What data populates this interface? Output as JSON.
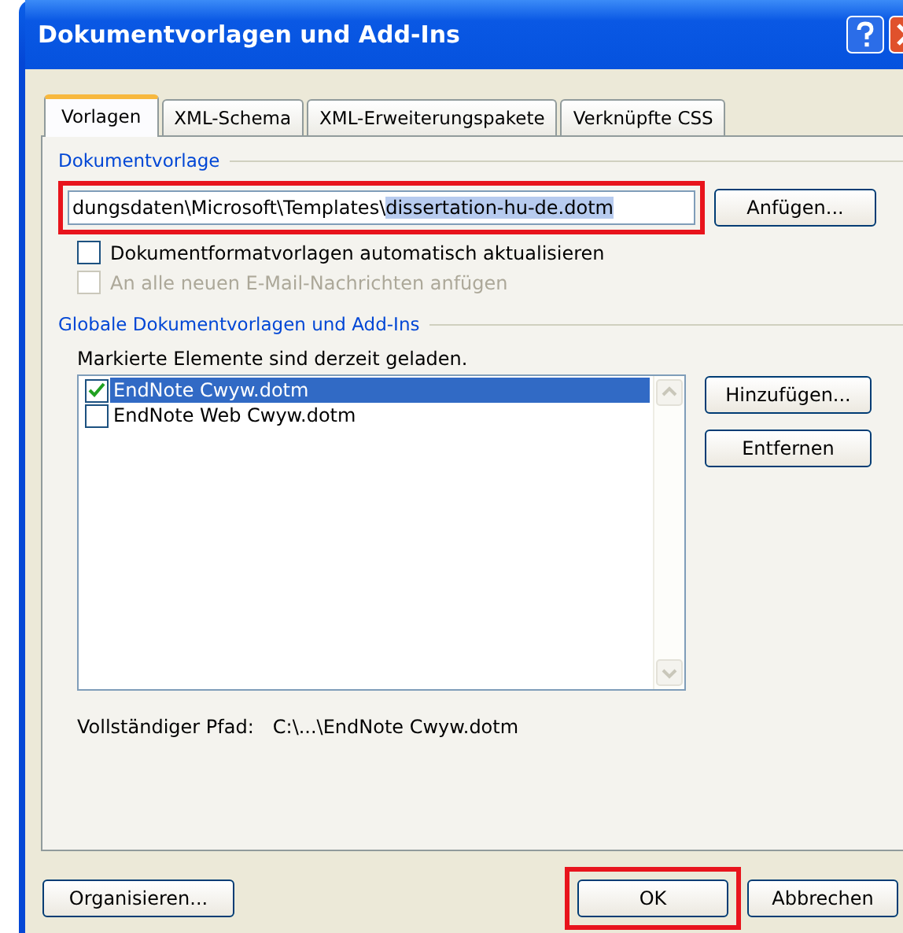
{
  "window": {
    "title": "Dokumentvorlagen und Add-Ins"
  },
  "tabs": [
    {
      "label": "Vorlagen",
      "selected": true
    },
    {
      "label": "XML-Schema",
      "selected": false
    },
    {
      "label": "XML-Erweiterungspakete",
      "selected": false
    },
    {
      "label": "Verknüpfte CSS",
      "selected": false
    }
  ],
  "template_section": {
    "heading": "Dokumentvorlage",
    "field": {
      "value": "dungsdaten\\Microsoft\\Templates\\",
      "selection": "dissertation-hu-de.dotm",
      "highlighted": true
    },
    "attach_button": "Anfügen...",
    "options": [
      {
        "label": "Dokumentformatvorlagen automatisch aktualisieren",
        "checked": false,
        "disabled": false
      },
      {
        "label": "An alle neuen E-Mail-Nachrichten anfügen",
        "checked": false,
        "disabled": true
      }
    ]
  },
  "global_section": {
    "heading": "Globale Dokumentvorlagen und Add-Ins",
    "hint": "Markierte Elemente sind derzeit geladen.",
    "items": [
      {
        "label": "EndNote Cwyw.dotm",
        "checked": true,
        "selected": true
      },
      {
        "label": "EndNote Web Cwyw.dotm",
        "checked": false,
        "selected": false
      }
    ],
    "buttons": [
      "Hinzufügen...",
      "Entfernen"
    ],
    "path_label": "Vollständiger Pfad:",
    "path_value": "C:\\...\\EndNote Cwyw.dotm"
  },
  "footer": {
    "organize_button": "Organisieren...",
    "ok_button": {
      "label": "OK",
      "highlighted": true
    },
    "cancel_button": "Abbrechen"
  }
}
